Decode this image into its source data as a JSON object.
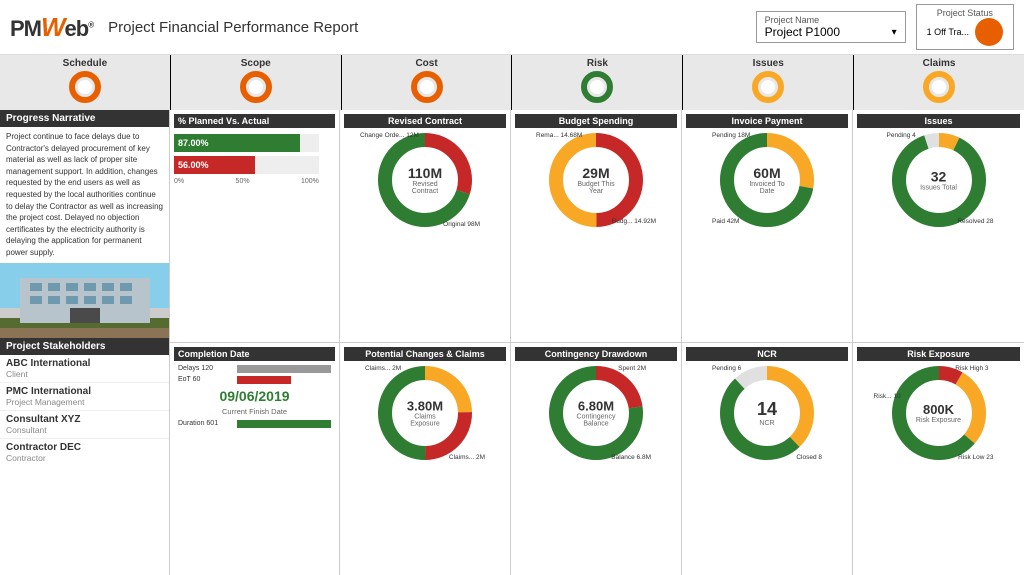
{
  "header": {
    "logo": "PMWeb",
    "logo_w": "W",
    "title": "Project Financial Performance Report",
    "project_name_label": "Project Name",
    "project_name_value": "Project P1000",
    "project_status_label": "Project Status",
    "project_status_sub": "1 Off Tra..."
  },
  "status_indicators": {
    "items": [
      {
        "label": "Schedule",
        "color": "#e85f00",
        "inner": "#fff"
      },
      {
        "label": "Scope",
        "color": "#e85f00",
        "inner": "#fff"
      },
      {
        "label": "Cost",
        "color": "#e85f00",
        "inner": "#fff"
      },
      {
        "label": "Risk",
        "color": "#2e7d32",
        "inner": "#fff"
      },
      {
        "label": "Issues",
        "color": "#f9a825",
        "inner": "#fff"
      },
      {
        "label": "Claims",
        "color": "#f9a825",
        "inner": "#fff"
      }
    ]
  },
  "progress_narrative": {
    "header": "Progress Narrative",
    "text": "Project continue to face delays due to Contractor's delayed procurement of key material as well as lack of proper site management support. In addition, changes requested by the end users as well as requested by the local authorities continue to delay the Contractor as well as increasing the project cost. Delayed no objection certificates by the electricity authority is delaying the application for permanent power supply."
  },
  "planned_vs_actual": {
    "header": "% Planned Vs. Actual",
    "planned_pct": "87.00%",
    "actual_pct": "56.00%",
    "axis_start": "0%",
    "axis_mid": "50%",
    "axis_end": "100%"
  },
  "revised_contract": {
    "header": "Revised Contract",
    "value": "110M",
    "label": "Revised Contract",
    "annotations": {
      "change_order": "Change Orde... 12M",
      "original": "Original 98M"
    },
    "colors": [
      "#c62828",
      "#2e7d32",
      "#f9a825"
    ]
  },
  "budget_spending": {
    "header": "Budget Spending",
    "value": "29M",
    "label": "Budget This Year",
    "annotations": {
      "remaining": "Rema... 14.68M",
      "budget": "Budg... 14.92M"
    }
  },
  "invoice_payment": {
    "header": "Invoice Payment",
    "value": "60M",
    "label": "Invoiced To Date",
    "annotations": {
      "pending": "Pending 18M",
      "paid": "Paid 42M"
    }
  },
  "issues_widget": {
    "header": "Issues",
    "value": "32",
    "label": "Issues Total",
    "annotations": {
      "pending": "Pending 4",
      "resolved": "Resolved 28"
    }
  },
  "completion_date": {
    "header": "Completion Date",
    "delays_label": "Delays 120",
    "eot_label": "EoT 60",
    "date": "09/06/2019",
    "date_label": "Current Finish Date",
    "duration_label": "Duration 601"
  },
  "potential_changes": {
    "header": "Potential Changes & Claims",
    "value": "3.80M",
    "label": "Claims Exposure",
    "annotations": {
      "claims_top": "Claims... 2M",
      "claims_bottom": "Claims... 2M"
    }
  },
  "contingency": {
    "header": "Contingency Drawdown",
    "value": "6.80M",
    "label": "Contingency Balance",
    "annotations": {
      "spent": "Spent 2M",
      "balance": "Balance 6.8M"
    }
  },
  "ncr": {
    "header": "NCR",
    "value": "14",
    "label": "NCR",
    "annotations": {
      "pending": "Pending 6",
      "closed": "Closed 8"
    }
  },
  "risk_exposure": {
    "header": "Risk Exposure",
    "value": "800K",
    "label": "Risk Exposure",
    "annotations": {
      "risk_high": "Risk High 3",
      "risk_med": "Risk... 10",
      "risk_low": "Risk Low 23"
    }
  },
  "stakeholders": {
    "header": "Project Stakeholders",
    "items": [
      {
        "name": "ABC International",
        "role": "Client"
      },
      {
        "name": "PMC International",
        "role": "Project Management"
      },
      {
        "name": "Consultant XYZ",
        "role": "Consultant"
      },
      {
        "name": "Contractor DEC",
        "role": "Contractor"
      }
    ]
  }
}
